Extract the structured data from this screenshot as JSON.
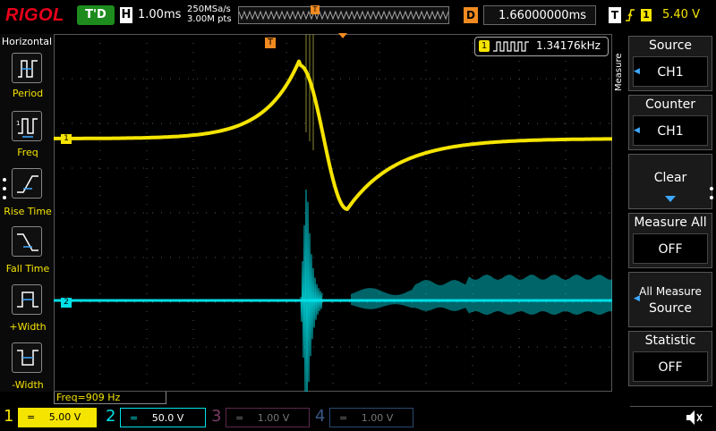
{
  "topbar": {
    "brand": "RIGOL",
    "run_state": "T'D",
    "horizontal_badge": "H",
    "timebase": "1.00ms",
    "sample_rate": "250MSa/s",
    "memory_points": "3.00M pts",
    "trigger_marker": "T",
    "delay_badge": "D",
    "delay_value": "1.66000000ms",
    "trigger_badge": "T",
    "trigger_source": "1",
    "trigger_level": "5.40 V"
  },
  "left_panel": {
    "title": "Horizontal",
    "items": [
      {
        "label": "Period",
        "icon": "period-icon"
      },
      {
        "label": "Freq",
        "icon": "frequency-icon"
      },
      {
        "label": "Rise Time",
        "icon": "rise-time-icon"
      },
      {
        "label": "Fall Time",
        "icon": "fall-time-icon"
      },
      {
        "label": "+Width",
        "icon": "positive-width-icon"
      },
      {
        "label": "-Width",
        "icon": "negative-width-icon"
      }
    ]
  },
  "waveform": {
    "trigger_marker": "T",
    "ch1_marker": "1",
    "ch2_marker": "2",
    "counter_channel": "1",
    "counter_value": "1.34176kHz"
  },
  "right_panel": {
    "menu_title": "Measure",
    "source": {
      "title": "Source",
      "value": "CH1"
    },
    "counter": {
      "title": "Counter",
      "value": "CH1"
    },
    "clear": {
      "title": "Clear"
    },
    "measure_all": {
      "title": "Measure All",
      "value": "OFF"
    },
    "all_measure_source": {
      "line1": "All Measure",
      "line2": "Source"
    },
    "statistic": {
      "title": "Statistic",
      "value": "OFF"
    }
  },
  "bottombar": {
    "freq_status": "Freq=909 Hz",
    "channels": [
      {
        "num": "1",
        "coupling": "=",
        "scale": "5.00 V",
        "color": "#f5e400",
        "active": true
      },
      {
        "num": "2",
        "coupling": "=",
        "scale": "50.0 V",
        "color": "#00e0e8",
        "active": true
      },
      {
        "num": "3",
        "coupling": "=",
        "scale": "1.00 V",
        "color": "#c02090",
        "active": false
      },
      {
        "num": "4",
        "coupling": "=",
        "scale": "1.00 V",
        "color": "#3a7bd5",
        "active": false
      }
    ]
  },
  "colors": {
    "ch1": "#f5e400",
    "ch2": "#00e0e8",
    "trigger": "#f08a20",
    "brand": "#e8001b",
    "run_state": "#1e8b1e"
  }
}
